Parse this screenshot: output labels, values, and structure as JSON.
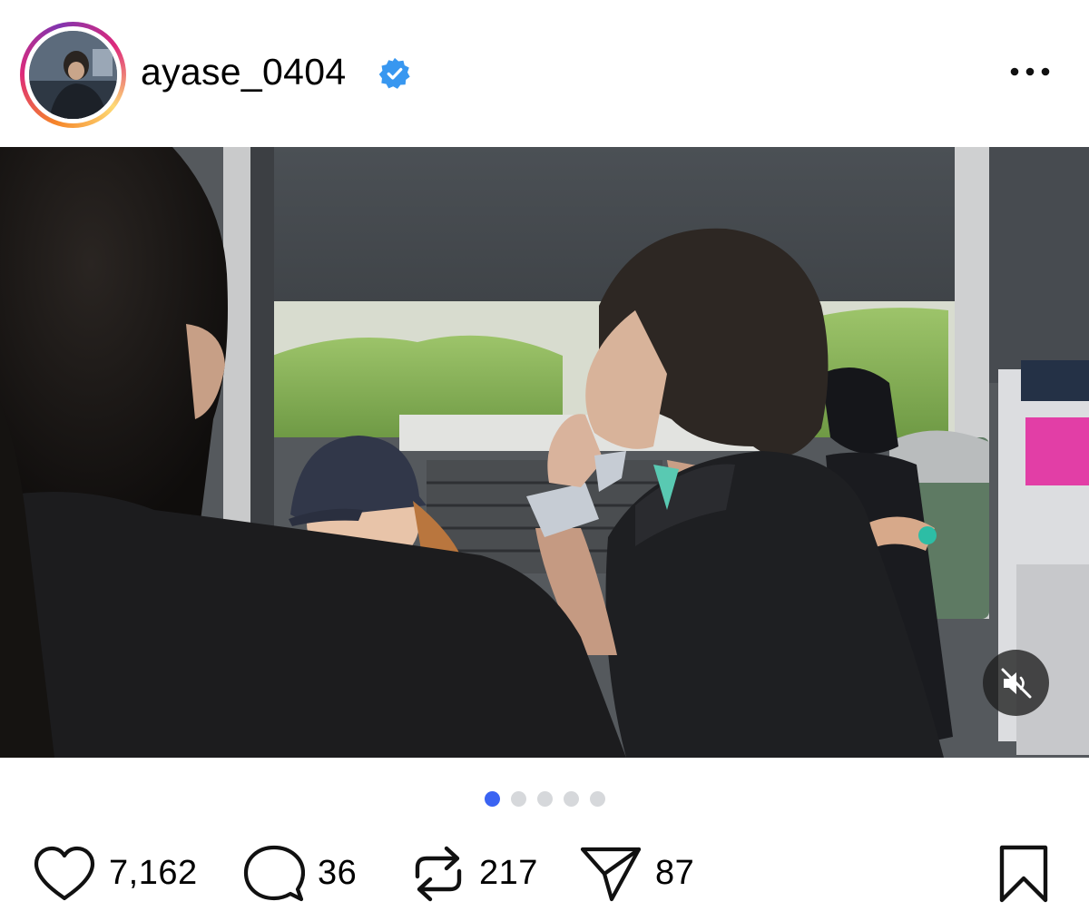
{
  "header": {
    "username": "ayase_0404",
    "verified": true,
    "more_icon": "more-horizontal-icon"
  },
  "media": {
    "mute_icon": "muted-speaker-icon",
    "carousel_count": 5,
    "carousel_active_index": 0
  },
  "actions": {
    "likes": "7,162",
    "comments": "36",
    "reposts": "217",
    "shares": "87"
  },
  "colors": {
    "verified_badge": "#3897f0",
    "dot_active": "#3a63f2",
    "dot_inactive": "#d6d8db"
  }
}
